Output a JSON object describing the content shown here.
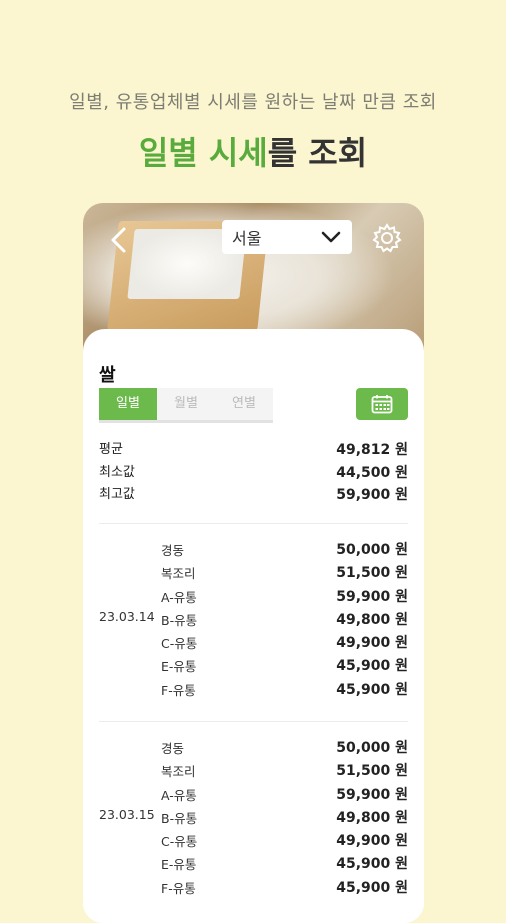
{
  "headline": {
    "subtitle": "일별, 유통업체별 시세를 원하는 날짜 만큼 조회",
    "title_accent": "일별 시세",
    "title_rest": "를 조회"
  },
  "topbar": {
    "back_icon": "chevron-left-icon",
    "region": "서울",
    "settings_icon": "gear-icon"
  },
  "item": {
    "title": "쌀"
  },
  "tabs": [
    {
      "label": "일별",
      "active": true
    },
    {
      "label": "월별",
      "active": false
    },
    {
      "label": "연별",
      "active": false
    }
  ],
  "calendar_icon": "calendar-icon",
  "colors": {
    "accent": "#6cba4c",
    "headline_accent": "#5aab3e",
    "background": "#fbf6cf"
  },
  "summary": [
    {
      "label": "평균",
      "value": "49,812 원"
    },
    {
      "label": "최소값",
      "value": "44,500 원"
    },
    {
      "label": "최고값",
      "value": "59,900 원"
    }
  ],
  "groups": [
    {
      "date": "23.03.14",
      "rows": [
        {
          "vendor": "경동",
          "price": "50,000 원"
        },
        {
          "vendor": "복조리",
          "price": "51,500 원"
        },
        {
          "vendor": "A-유통",
          "price": "59,900 원"
        },
        {
          "vendor": "B-유통",
          "price": "49,800 원"
        },
        {
          "vendor": "C-유통",
          "price": "49,900 원"
        },
        {
          "vendor": "E-유통",
          "price": "45,900 원"
        },
        {
          "vendor": "F-유통",
          "price": "45,900 원"
        }
      ]
    },
    {
      "date": "23.03.15",
      "rows": [
        {
          "vendor": "경동",
          "price": "50,000 원"
        },
        {
          "vendor": "복조리",
          "price": "51,500 원"
        },
        {
          "vendor": "A-유통",
          "price": "59,900 원"
        },
        {
          "vendor": "B-유통",
          "price": "49,800 원"
        },
        {
          "vendor": "C-유통",
          "price": "49,900 원"
        },
        {
          "vendor": "E-유통",
          "price": "45,900 원"
        },
        {
          "vendor": "F-유통",
          "price": "45,900 원"
        }
      ]
    }
  ]
}
